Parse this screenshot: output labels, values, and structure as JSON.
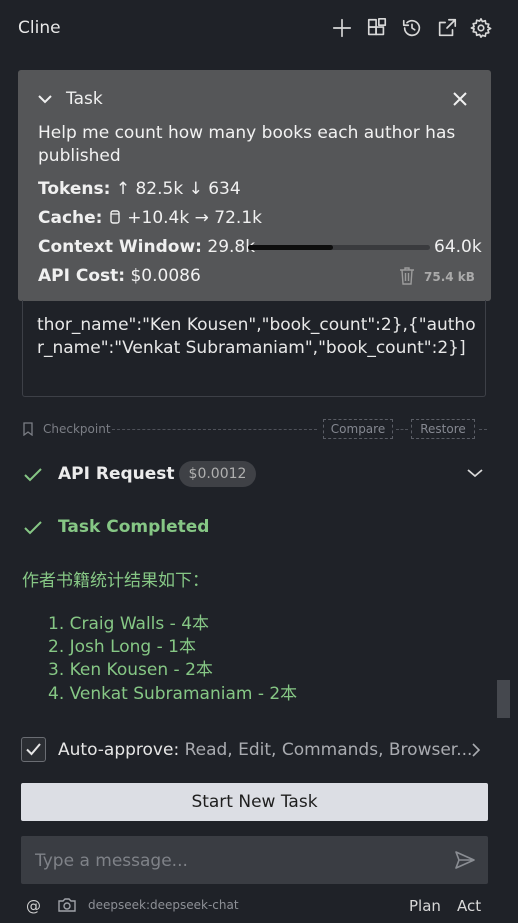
{
  "header": {
    "title": "Cline",
    "icons": [
      "plus-icon",
      "mcp-servers-icon",
      "history-icon",
      "popout-icon",
      "gear-icon"
    ]
  },
  "task": {
    "title": "Task",
    "text": "Help me count how many books each author has published",
    "tokens_label": "Tokens:",
    "tokens_in": "↑ 82.5k",
    "tokens_out": "↓ 634",
    "cache_label": "Cache:",
    "cache_write": "+10.4k",
    "cache_read": "→ 72.1k",
    "context_label": "Context Window:",
    "context_used": "29.8k",
    "context_max": "64.0k",
    "context_fraction": 0.466,
    "cost_label": "API Cost:",
    "cost_value": "$0.0086",
    "size": "75.4 kB"
  },
  "code_output": "thor_name\":\"Ken Kousen\",\"book_count\":2},{\"author_name\":\"Venkat Subramaniam\",\"book_count\":2}]",
  "checkpoint": {
    "label": "Checkpoint",
    "compare": "Compare",
    "restore": "Restore"
  },
  "api_request": {
    "label": "API Request",
    "cost": "$0.0012"
  },
  "completion": {
    "label": "Task Completed",
    "intro": "作者书籍统计结果如下：",
    "items": [
      "1. Craig Walls - 4本",
      "2. Josh Long - 1本",
      "3. Ken Kousen - 2本",
      "4. Venkat Subramaniam - 2本"
    ]
  },
  "auto_approve": {
    "label": "Auto-approve:",
    "value": "Read, Edit, Commands, Browser...",
    "checked": true
  },
  "start_new_task": "Start New Task",
  "message": {
    "placeholder": "Type a message..."
  },
  "footer": {
    "at": "@",
    "model": "deepseek:deepseek-chat",
    "plan": "Plan",
    "act": "Act"
  },
  "colors": {
    "background": "#1f2228",
    "task_card": "#555658",
    "success_green": "#86c785",
    "button_light": "#dcdee4"
  }
}
